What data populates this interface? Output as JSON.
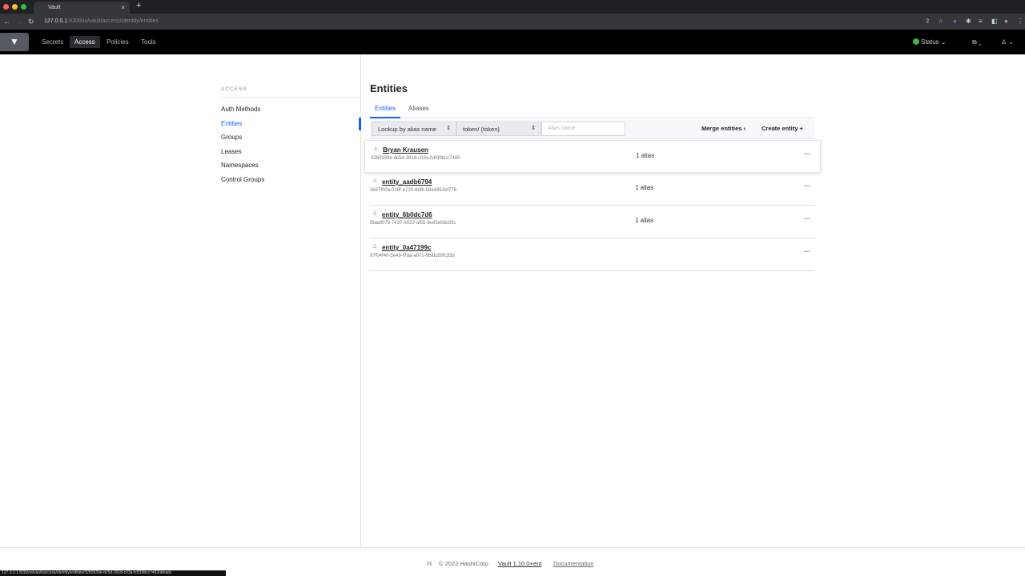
{
  "browser": {
    "tab_title": "Vault",
    "url_host": "127.0.0.1",
    "url_path": ":8200/ui/vault/access/identity/entities",
    "status_url": "127.0.0.1:8200/ui/vault/access/identity/entities/3280939e-dc5d-3918-c03a-fc839bcc7483/details"
  },
  "nav": {
    "items": [
      "Secrets",
      "Access",
      "Policies",
      "Tools"
    ],
    "status": "Status"
  },
  "sidebar": {
    "heading": "ACCESS",
    "items": [
      "Auth Methods",
      "Entities",
      "Groups",
      "Leases",
      "Namespaces",
      "Control Groups"
    ]
  },
  "main": {
    "title": "Entities",
    "tabs": [
      "Entities",
      "Aliases"
    ],
    "toolbar": {
      "lookup": "Lookup by alias name",
      "mount": "token/ (token)",
      "alias_placeholder": "Alias name",
      "merge": "Merge entities",
      "create": "Create entity"
    },
    "rows": [
      {
        "name": "Bryan Krausen",
        "id": "3280939e-dc5d-3918-c03a-fc839bcc7483",
        "aliases": "1 alias"
      },
      {
        "name": "entity_aadb6794",
        "id": "3e57f00a-028f-e720-8bf6-58e4d52ef776",
        "aliases": "1 alias"
      },
      {
        "name": "entity_6b0dc7d6",
        "id": "5baaf07b-7437-3020-af55-feef3e0dc93c",
        "aliases": "1 alias"
      },
      {
        "name": "entity_0a47199c",
        "id": "97f04f40-5e49-f7da-a071-9bfdc89fc33d",
        "aliases": ""
      }
    ]
  },
  "footer": {
    "copyright": "© 2022 HashiCorp",
    "version": "Vault 1.10.0+ent",
    "docs": "Documentation"
  }
}
